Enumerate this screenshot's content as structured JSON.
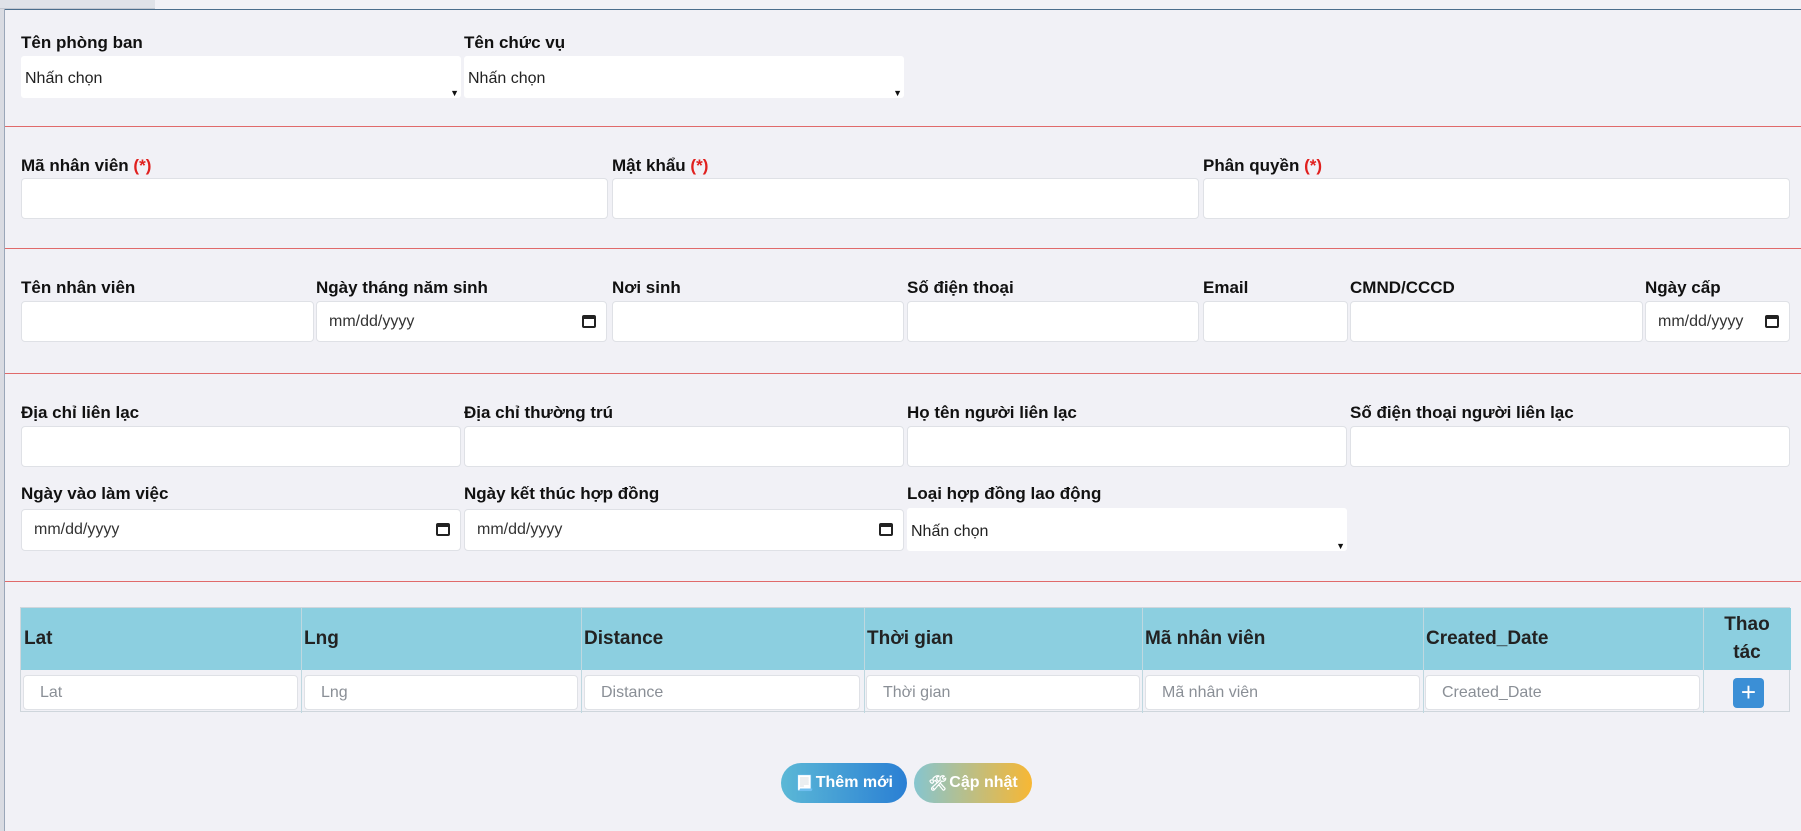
{
  "row1": {
    "department": {
      "label": "Tên phòng ban",
      "value": "Nhấn chọn"
    },
    "position": {
      "label": "Tên chức vụ",
      "value": "Nhấn chọn"
    }
  },
  "row2": {
    "employee_code": {
      "label": "Mã nhân viên",
      "req": "(*)"
    },
    "password": {
      "label": "Mật khẩu",
      "req": "(*)"
    },
    "permission": {
      "label": "Phân quyền",
      "req": "(*)"
    }
  },
  "row3": {
    "employee_name": {
      "label": "Tên nhân viên"
    },
    "birthdate": {
      "label": "Ngày tháng năm sinh",
      "placeholder": "mm/dd/yyyy"
    },
    "birthplace": {
      "label": "Nơi sinh"
    },
    "phone": {
      "label": "Số điện thoại"
    },
    "email": {
      "label": "Email"
    },
    "id_card": {
      "label": "CMND/CCCD"
    },
    "issue_date": {
      "label": "Ngày cấp",
      "placeholder": "mm/dd/yyyy"
    }
  },
  "row4": {
    "contact_address": {
      "label": "Địa chỉ liên lạc"
    },
    "permanent_address": {
      "label": "Địa chỉ thường trú"
    },
    "contact_name": {
      "label": "Họ tên người liên lạc"
    },
    "contact_phone": {
      "label": "Số điện thoại người liên lạc"
    }
  },
  "row5": {
    "start_date": {
      "label": "Ngày vào làm việc",
      "placeholder": "mm/dd/yyyy"
    },
    "contract_end": {
      "label": "Ngày kết thúc hợp đồng",
      "placeholder": "mm/dd/yyyy"
    },
    "contract_type": {
      "label": "Loại hợp đồng lao động",
      "value": "Nhấn chọn"
    }
  },
  "table": {
    "headers": [
      "Lat",
      "Lng",
      "Distance",
      "Thời gian",
      "Mã nhân viên",
      "Created_Date"
    ],
    "action_header_1": "Thao",
    "action_header_2": "tác",
    "placeholders": [
      "Lat",
      "Lng",
      "Distance",
      "Thời gian",
      "Mã nhân viên",
      "Created_Date"
    ],
    "add_row_icon": "+"
  },
  "buttons": {
    "add": {
      "label": "Thêm mới",
      "icon": "📃"
    },
    "update": {
      "label": "Cập nhật",
      "icon": "🛠"
    }
  },
  "colors": {
    "separator": "#e06a6a",
    "table_header": "#8ccfe0",
    "required": "#e0201e"
  }
}
